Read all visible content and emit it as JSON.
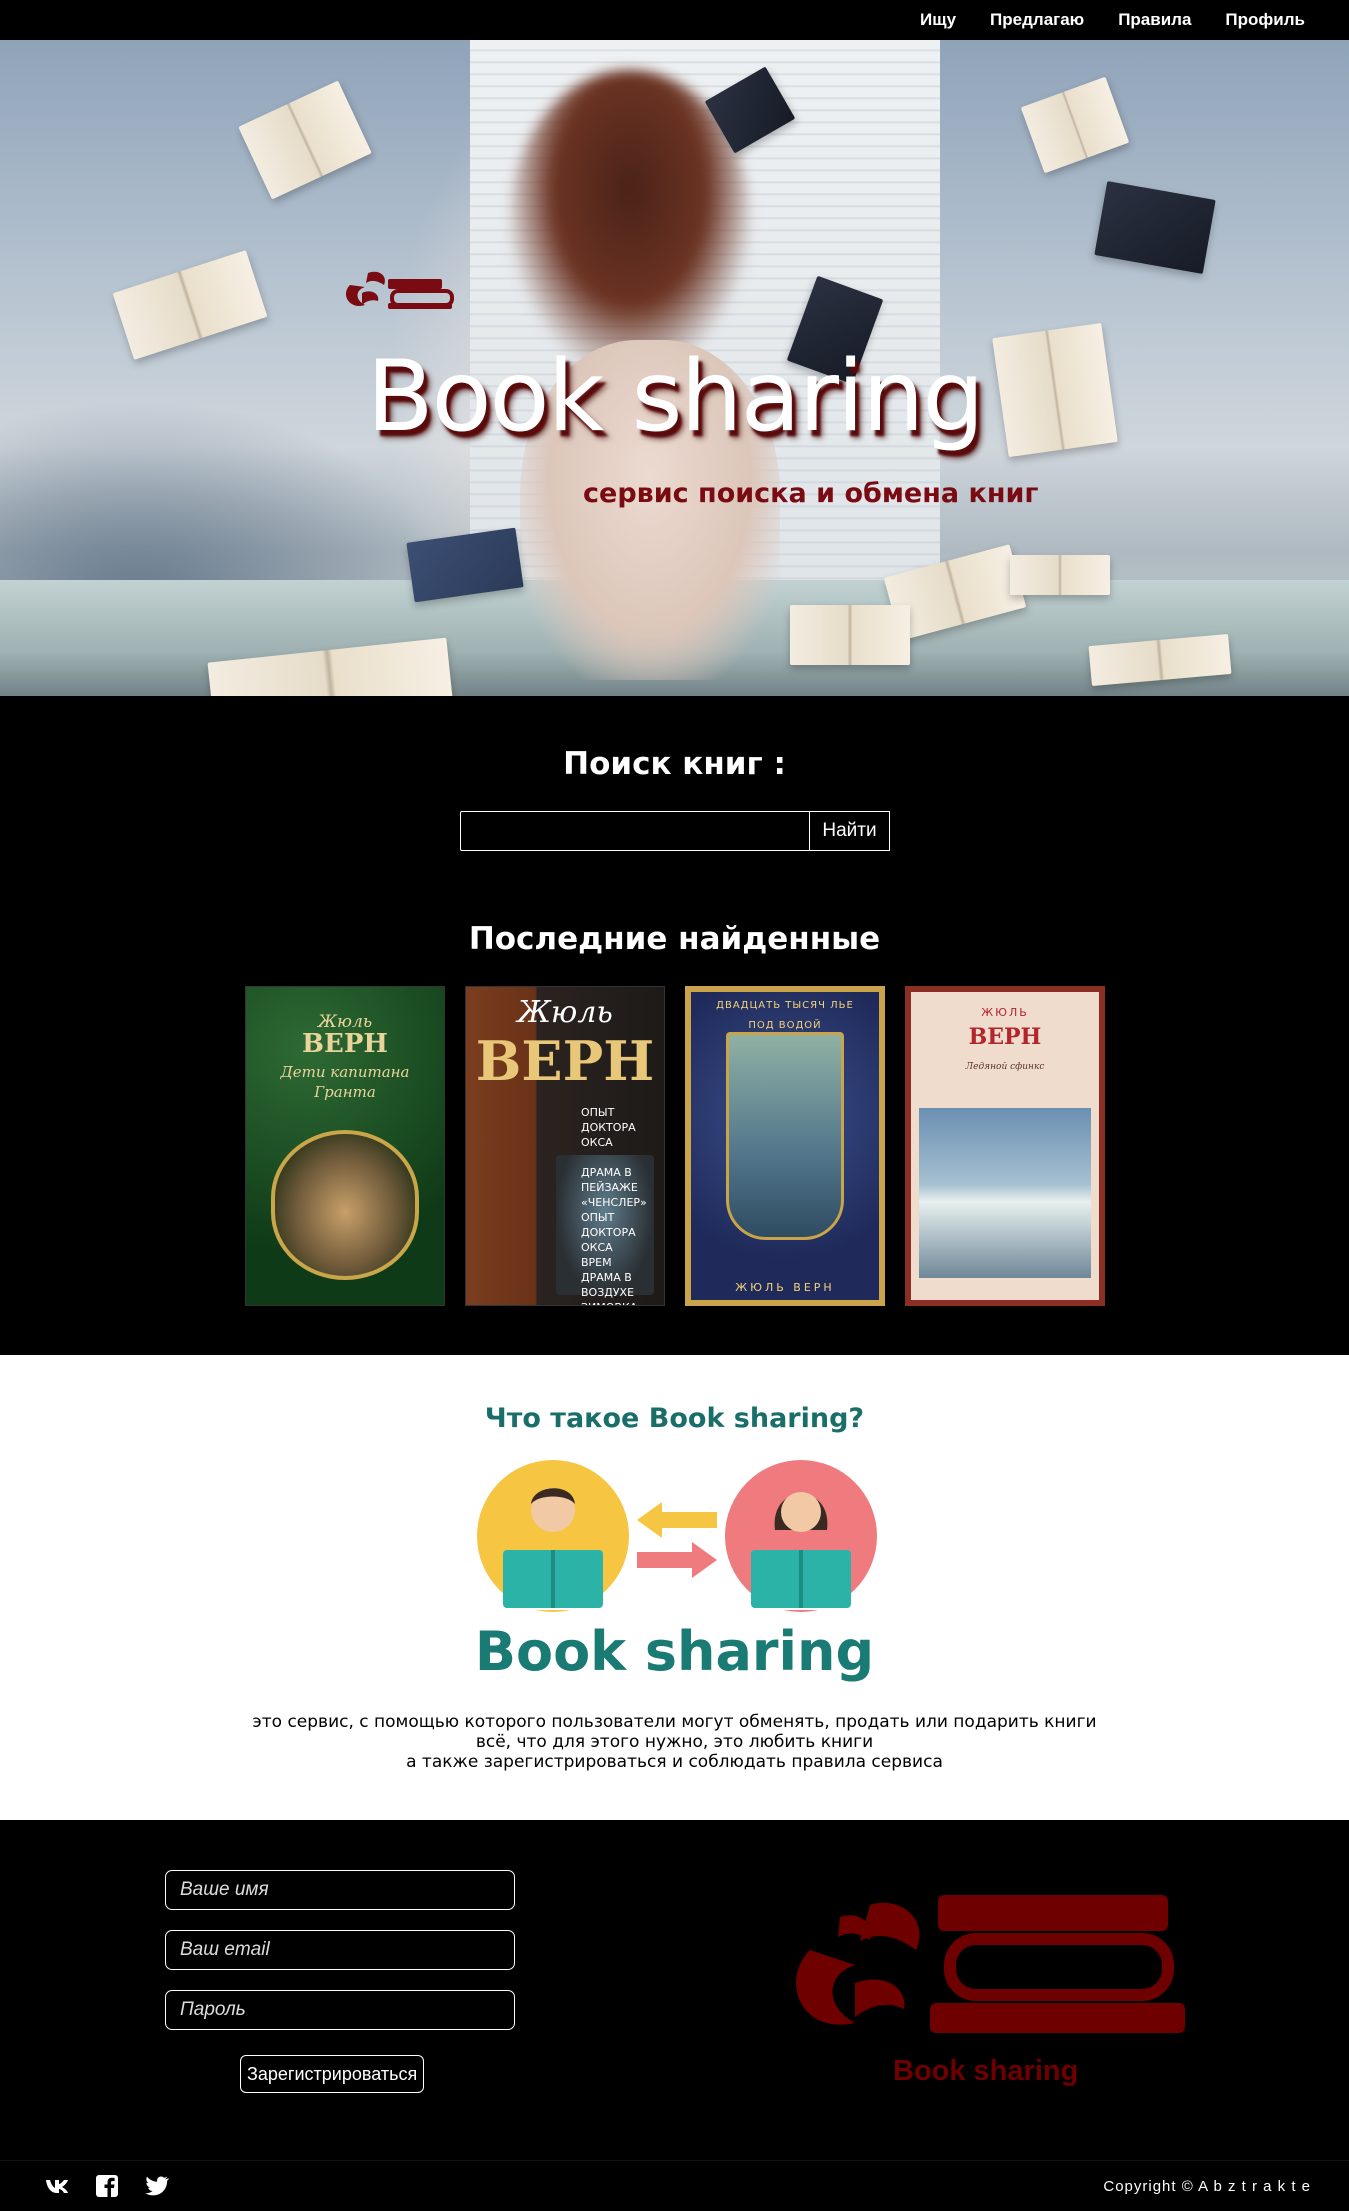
{
  "nav": {
    "items": [
      "Ищу",
      "Предлагаю",
      "Правила",
      "Профиль"
    ]
  },
  "hero": {
    "title": "Book sharing",
    "subtitle": "сервис поиска и обмена книг",
    "logo_icon": "book-sharing-logo-icon"
  },
  "search": {
    "title": "Поиск книг :",
    "input_value": "",
    "button_label": "Найти"
  },
  "recent": {
    "title": "Последние найденные",
    "books": [
      {
        "author": "Жюль",
        "surname": "ВЕРН",
        "title": "Дети капитана Гранта"
      },
      {
        "author": "Жюль",
        "surname": "ВЕРН",
        "title": "ОПЫТ ДОКТОРА ОКСА\n\nДРАМА В ПЕЙЗАЖЕ\n«ЧЕНСЛЕР»\nОПЫТ ДОКТОРА ОКСА\nВРЕМ\nДРАМА В ВОЗДУХЕ\nЗИМОВКА ВО ЛЬДАХ"
      },
      {
        "author": "",
        "surname": "ЖЮЛЬ ВЕРН",
        "title": "ДВАДЦАТЬ ТЫСЯЧ ЛЬЕ ПОД ВОДОЙ"
      },
      {
        "author": "ЖЮЛЬ",
        "surname": "ВЕРН",
        "title": "Ледяной сфинкс"
      }
    ]
  },
  "about": {
    "title": "Что такое Book sharing?",
    "brand": "Book sharing",
    "lines": [
      "это сервис, с помощью которого пользователи могут обменять, продать или подарить книги",
      "всё, что для этого нужно, это любить книги",
      "а также зарегистрироваться и соблюдать правила сервиса"
    ]
  },
  "register": {
    "name_placeholder": "Ваше имя",
    "email_placeholder": "Ваш email",
    "password_placeholder": "Пароль",
    "button_label": "Зарегистрироваться",
    "logo_text": "Book sharing"
  },
  "footer": {
    "social": [
      "vk-icon",
      "facebook-icon",
      "twitter-icon"
    ],
    "copyright": "Copyright © A b z t r a k t e"
  },
  "colors": {
    "brand_dark_red": "#6e0000",
    "teal": "#1a7a74",
    "background": "#000000"
  }
}
